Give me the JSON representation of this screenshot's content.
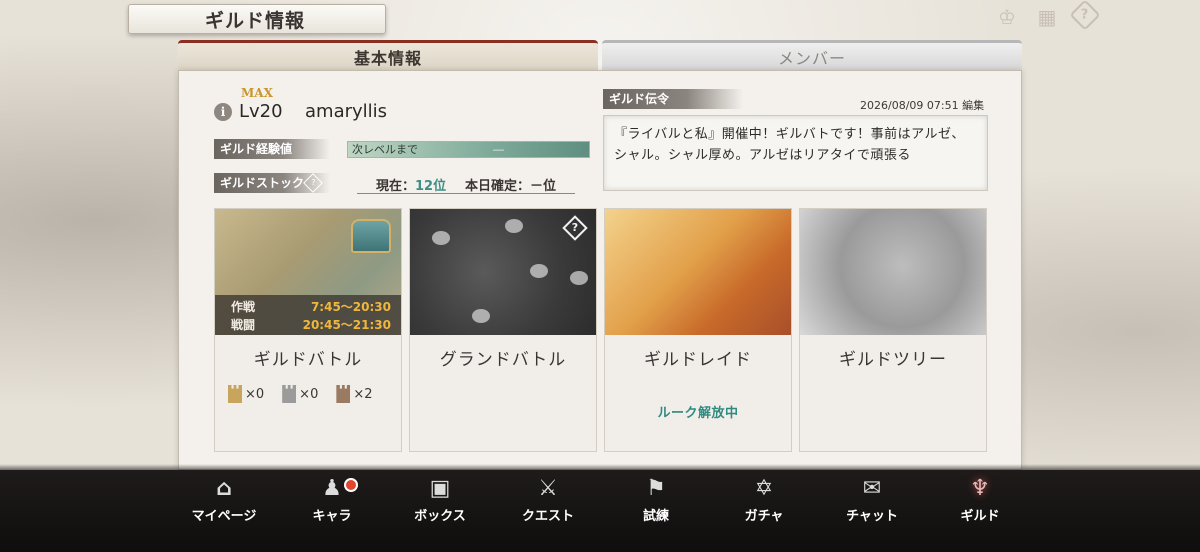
{
  "header": {
    "title": "ギルド情報",
    "icons": [
      "crown-icon",
      "calendar-icon",
      "help-icon"
    ]
  },
  "tabs": [
    {
      "label": "基本情報",
      "active": true
    },
    {
      "label": "メンバー",
      "active": false
    }
  ],
  "guild": {
    "max_label": "MAX",
    "level": "Lv20",
    "name": "amaryllis",
    "exp_label": "ギルド経験値",
    "exp_bar_text": "次レベルまで",
    "exp_bar_value": "―",
    "stock_label": "ギルドストック",
    "stock_current_label": "現在：",
    "stock_current_value": "12位",
    "stock_today": "本日確定：－位"
  },
  "notice": {
    "label": "ギルド伝令",
    "date": "2026/08/09 07:51 編集",
    "text": "『ライバルと私』開催中！ギルバトです！事前はアルゼ、シャル。シャル厚め。アルゼはリアタイで頑張る"
  },
  "cards": [
    {
      "name": "ギルドバトル",
      "schedule": [
        {
          "label": "作戦",
          "time": "7:45～20:30"
        },
        {
          "label": "戦闘",
          "time": "20:45～21:30"
        }
      ],
      "towers": [
        {
          "icon": "gold-tower-icon",
          "count": "×0"
        },
        {
          "icon": "silver-tower-icon",
          "count": "×0"
        },
        {
          "icon": "bronze-tower-icon",
          "count": "×2"
        }
      ]
    },
    {
      "name": "グランドバトル"
    },
    {
      "name": "ギルドレイド",
      "status": "ルーク解放中"
    },
    {
      "name": "ギルドツリー"
    }
  ],
  "nav": [
    {
      "label": "マイページ",
      "icon": "home-icon"
    },
    {
      "label": "キャラ",
      "icon": "characters-icon",
      "badge": true
    },
    {
      "label": "ボックス",
      "icon": "box-icon"
    },
    {
      "label": "クエスト",
      "icon": "swords-icon"
    },
    {
      "label": "試練",
      "icon": "flag-icon"
    },
    {
      "label": "ガチャ",
      "icon": "gacha-icon"
    },
    {
      "label": "チャット",
      "icon": "chat-icon"
    },
    {
      "label": "ギルド",
      "icon": "guild-icon",
      "active": true
    }
  ],
  "colors": {
    "accent_teal": "#2f8a80",
    "accent_gold": "#f0b73a",
    "tab_active_top": "#8a2f22",
    "badge_red": "#e0452e"
  }
}
